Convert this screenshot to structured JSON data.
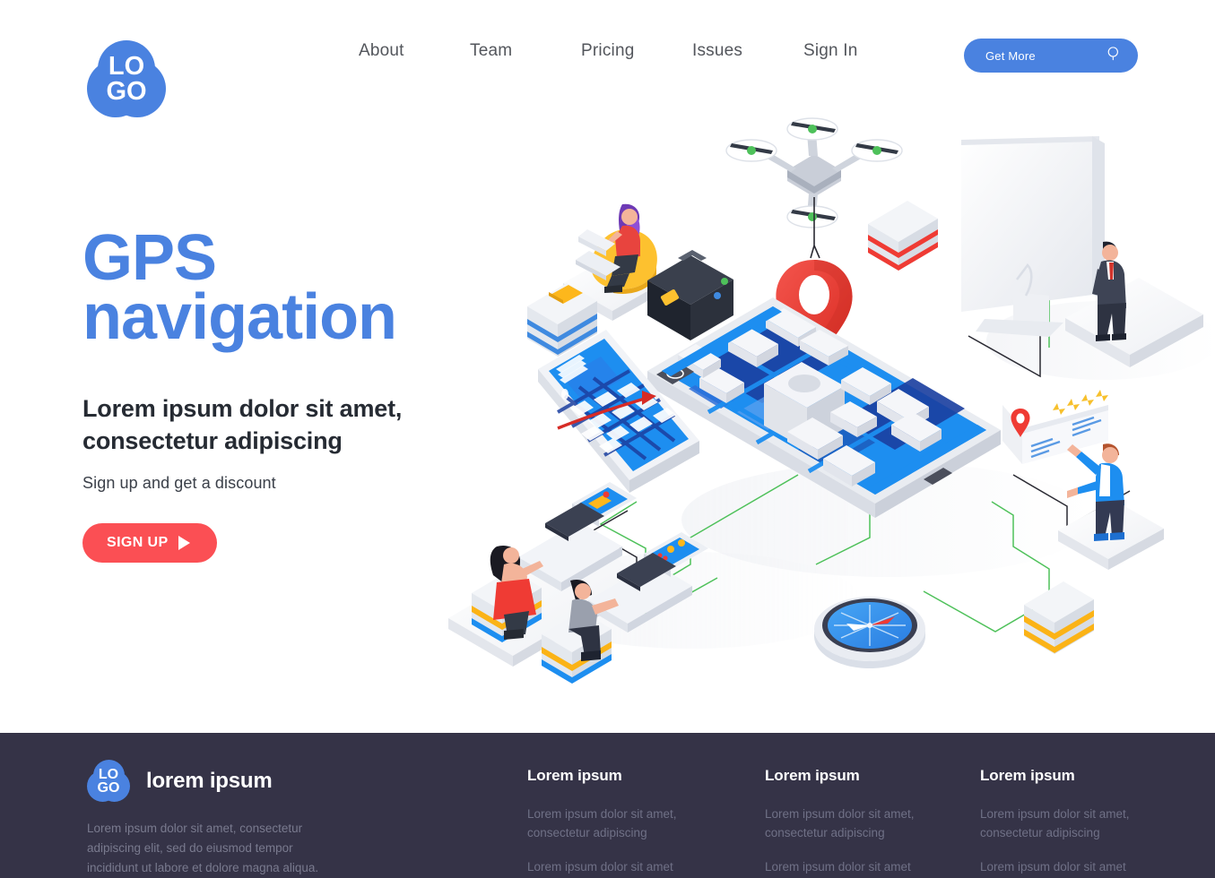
{
  "header": {
    "logo": {
      "name": "LOGO",
      "line1": "LO",
      "line2": "GO",
      "color": "#4a82e0"
    },
    "nav": [
      {
        "label": "About"
      },
      {
        "label": "Team"
      },
      {
        "label": "Pricing"
      },
      {
        "label": "Issues"
      },
      {
        "label": "Sign In"
      }
    ],
    "cta": {
      "label": "Get More",
      "icon": "search-icon",
      "bg": "#4a82e0"
    }
  },
  "hero": {
    "title_line1": "GPS",
    "title_line2": "navigation",
    "title_color": "#4a82e0",
    "subtitle": "Lorem ipsum dolor sit amet, consectetur adipiscing",
    "note": "Sign up and get a discount",
    "button": {
      "label": "SIGN UP",
      "icon": "play-icon",
      "bg": "#fb4f54"
    }
  },
  "illustration": {
    "alt": "Isometric GPS navigation scene",
    "colors": {
      "map_blue": "#1d8ef0",
      "map_dark_blue": "#1b3fa0",
      "pin_red": "#ef3b34",
      "green_wire": "#4ec15a",
      "black_wire": "#2a2a33",
      "platform": "#f2f3f6",
      "yellow": "#fbb316",
      "star_yellow": "#f7c02c"
    },
    "elements": [
      "drone",
      "gps-pin",
      "smartphone-map",
      "tablet-map",
      "compass",
      "desktop-monitor",
      "businessman",
      "woman-on-beanbag",
      "suitcase",
      "workstation-operators",
      "rating-card",
      "reviewer-person",
      "stack-blue",
      "stack-red",
      "stack-yellow"
    ],
    "rating_card": {
      "stars": 4,
      "pin": "location-pin-icon"
    }
  },
  "footer": {
    "bg": "#353347",
    "logo": {
      "line1": "LO",
      "line2": "GO"
    },
    "brand": "lorem ipsum",
    "about": "Lorem ipsum dolor sit amet, consectetur adipiscing elit, sed do eiusmod tempor incididunt ut labore et dolore magna aliqua.",
    "columns": [
      {
        "title": "Lorem ipsum",
        "line1": "Lorem ipsum dolor sit amet, consectetur adipiscing",
        "line2": "Lorem ipsum dolor sit amet"
      },
      {
        "title": "Lorem ipsum",
        "line1": "Lorem ipsum dolor sit amet, consectetur adipiscing",
        "line2": "Lorem ipsum dolor sit amet"
      },
      {
        "title": "Lorem ipsum",
        "line1": "Lorem ipsum dolor sit amet, consectetur adipiscing",
        "line2": "Lorem ipsum dolor sit amet"
      }
    ]
  }
}
